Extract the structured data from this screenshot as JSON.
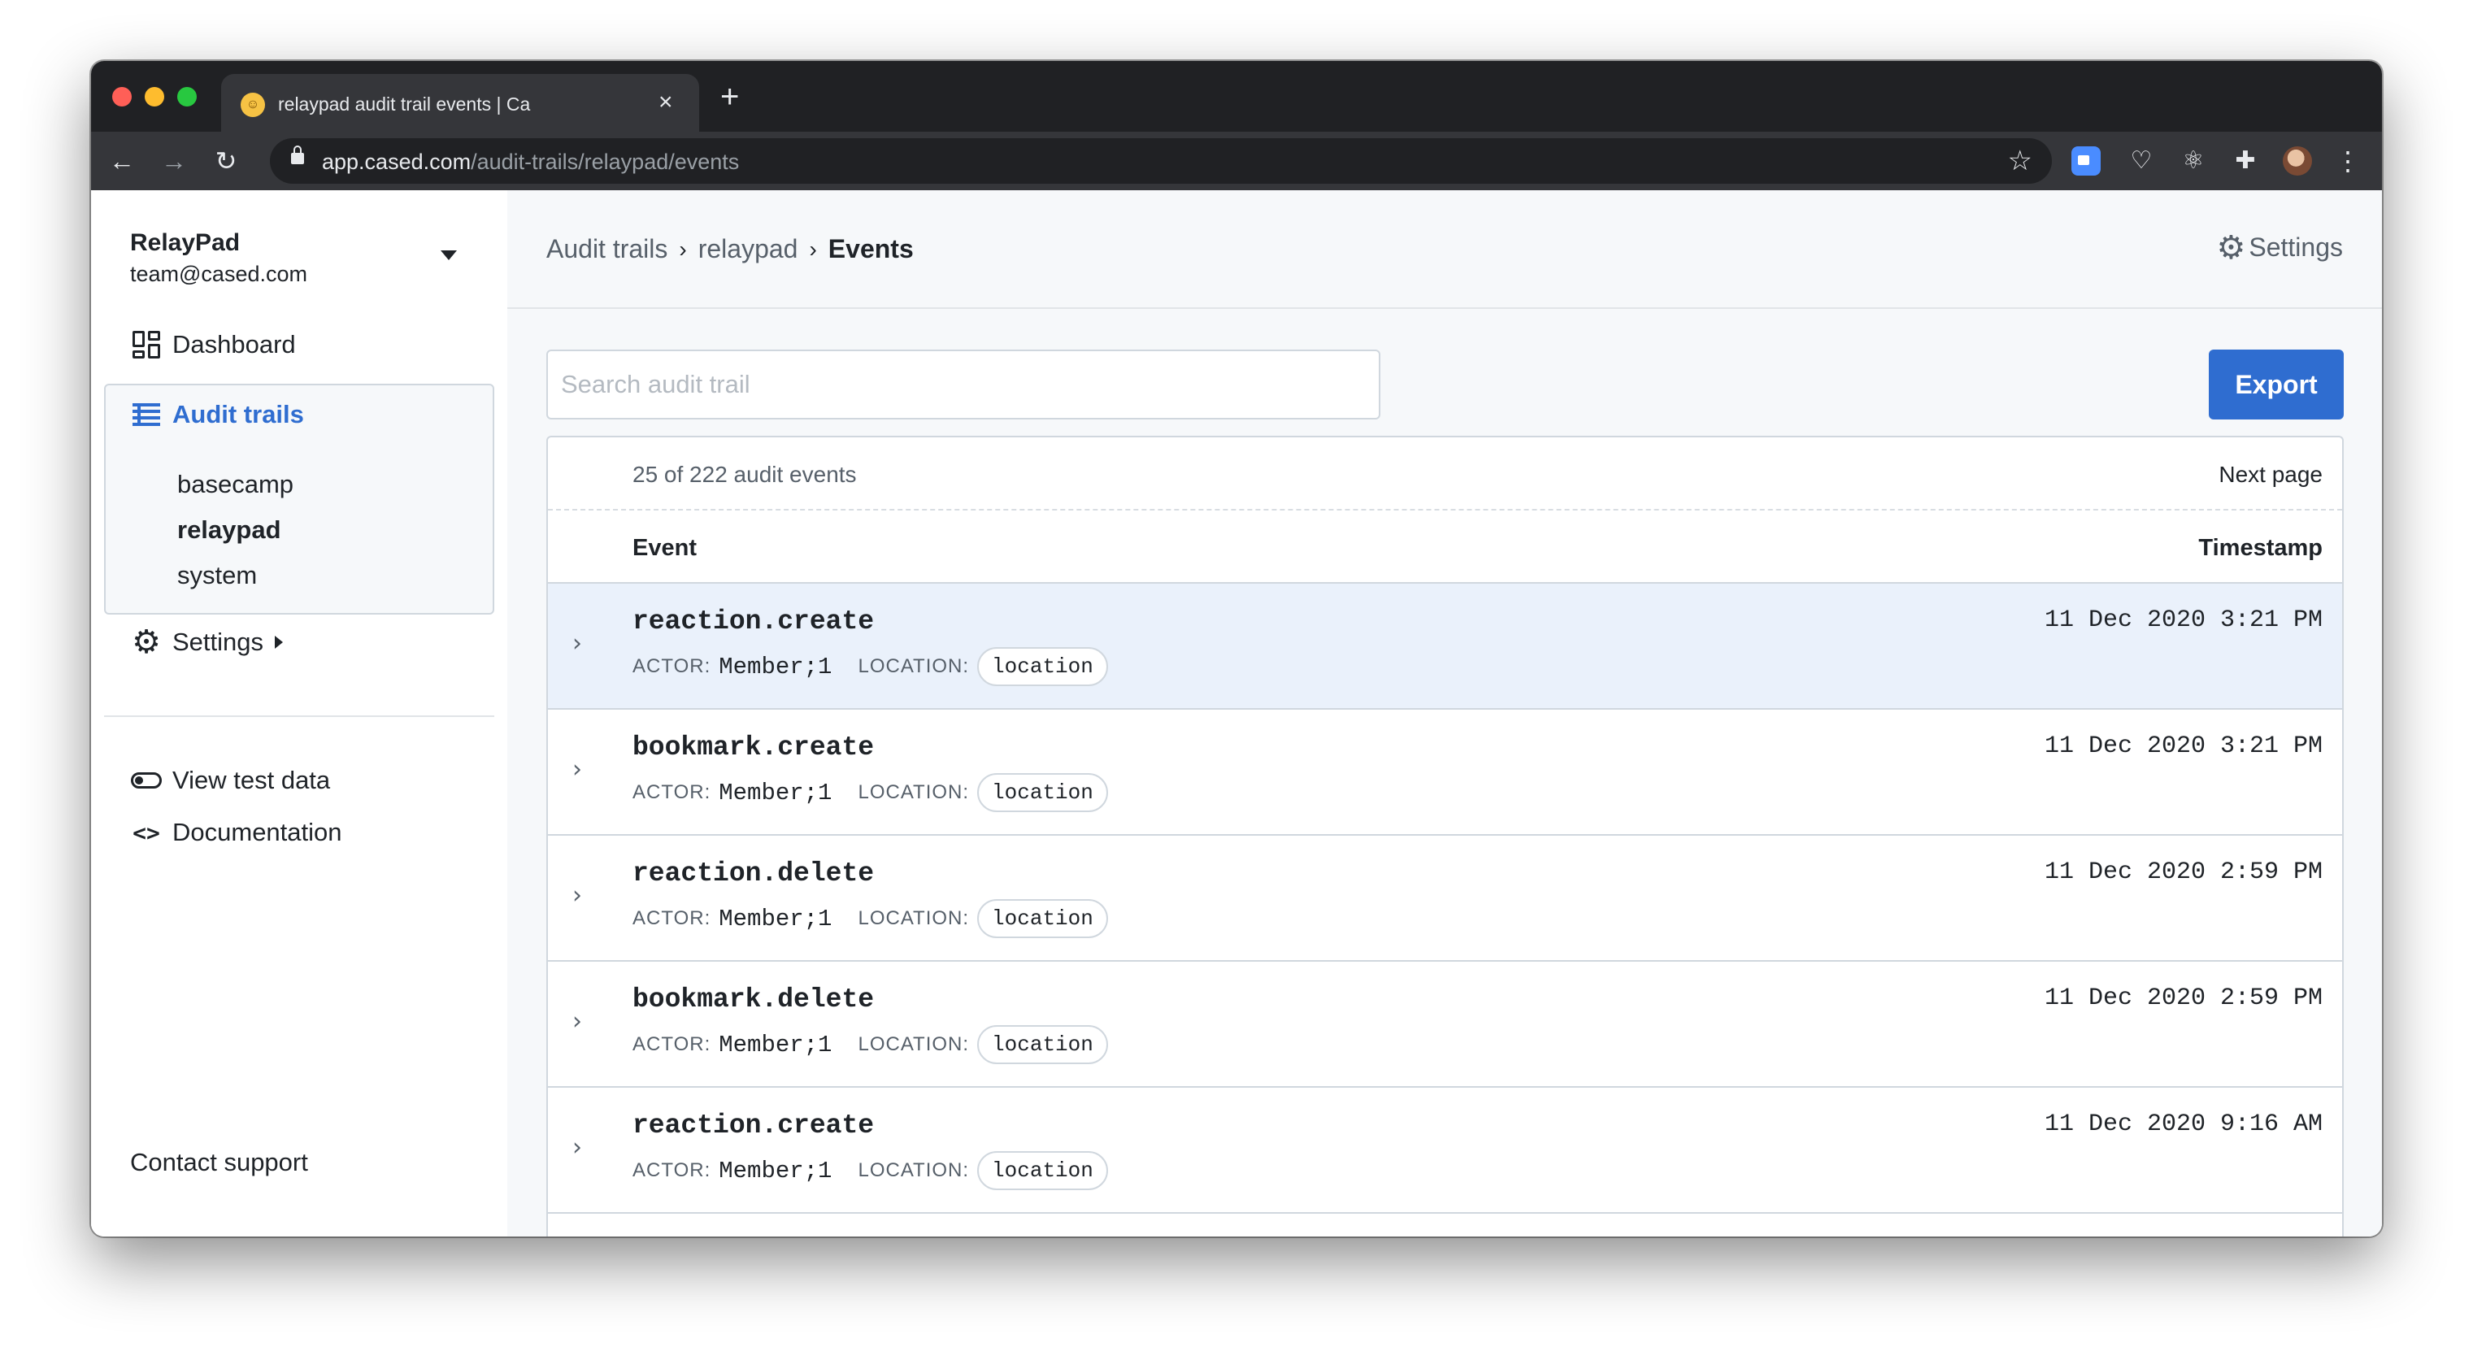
{
  "browser": {
    "tab_title": "relaypad audit trail events | Ca",
    "tab_close": "×",
    "new_tab": "+",
    "url_host": "app.cased.com",
    "url_path": "/audit-trails/relaypad/events"
  },
  "sidebar": {
    "org_name": "RelayPad",
    "org_email": "team@cased.com",
    "dashboard_label": "Dashboard",
    "audit_trails_label": "Audit trails",
    "audit_trails": [
      "basecamp",
      "relaypad",
      "system"
    ],
    "settings_label": "Settings",
    "view_test_data_label": "View test data",
    "documentation_label": "Documentation",
    "contact_support_label": "Contact support"
  },
  "header": {
    "breadcrumb": [
      "Audit trails",
      "relaypad",
      "Events"
    ],
    "settings_label": "Settings"
  },
  "search": {
    "placeholder": "Search audit trail"
  },
  "export_label": "Export",
  "table": {
    "count_text": "25 of 222 audit events",
    "next_page_label": "Next page",
    "columns": [
      "Event",
      "Timestamp"
    ],
    "actor_key": "ACTOR:",
    "location_key": "LOCATION:",
    "rows": [
      {
        "event": "reaction.create",
        "actor": "Member;1",
        "location": "location",
        "timestamp": "11 Dec 2020 3:21 PM"
      },
      {
        "event": "bookmark.create",
        "actor": "Member;1",
        "location": "location",
        "timestamp": "11 Dec 2020 3:21 PM"
      },
      {
        "event": "reaction.delete",
        "actor": "Member;1",
        "location": "location",
        "timestamp": "11 Dec 2020 2:59 PM"
      },
      {
        "event": "bookmark.delete",
        "actor": "Member;1",
        "location": "location",
        "timestamp": "11 Dec 2020 2:59 PM"
      },
      {
        "event": "reaction.create",
        "actor": "Member;1",
        "location": "location",
        "timestamp": "11 Dec 2020 9:16 AM"
      }
    ]
  },
  "colors": {
    "accent": "#2f6dd0",
    "selected_row": "#eaf1fb",
    "chrome_dark": "#202124"
  }
}
